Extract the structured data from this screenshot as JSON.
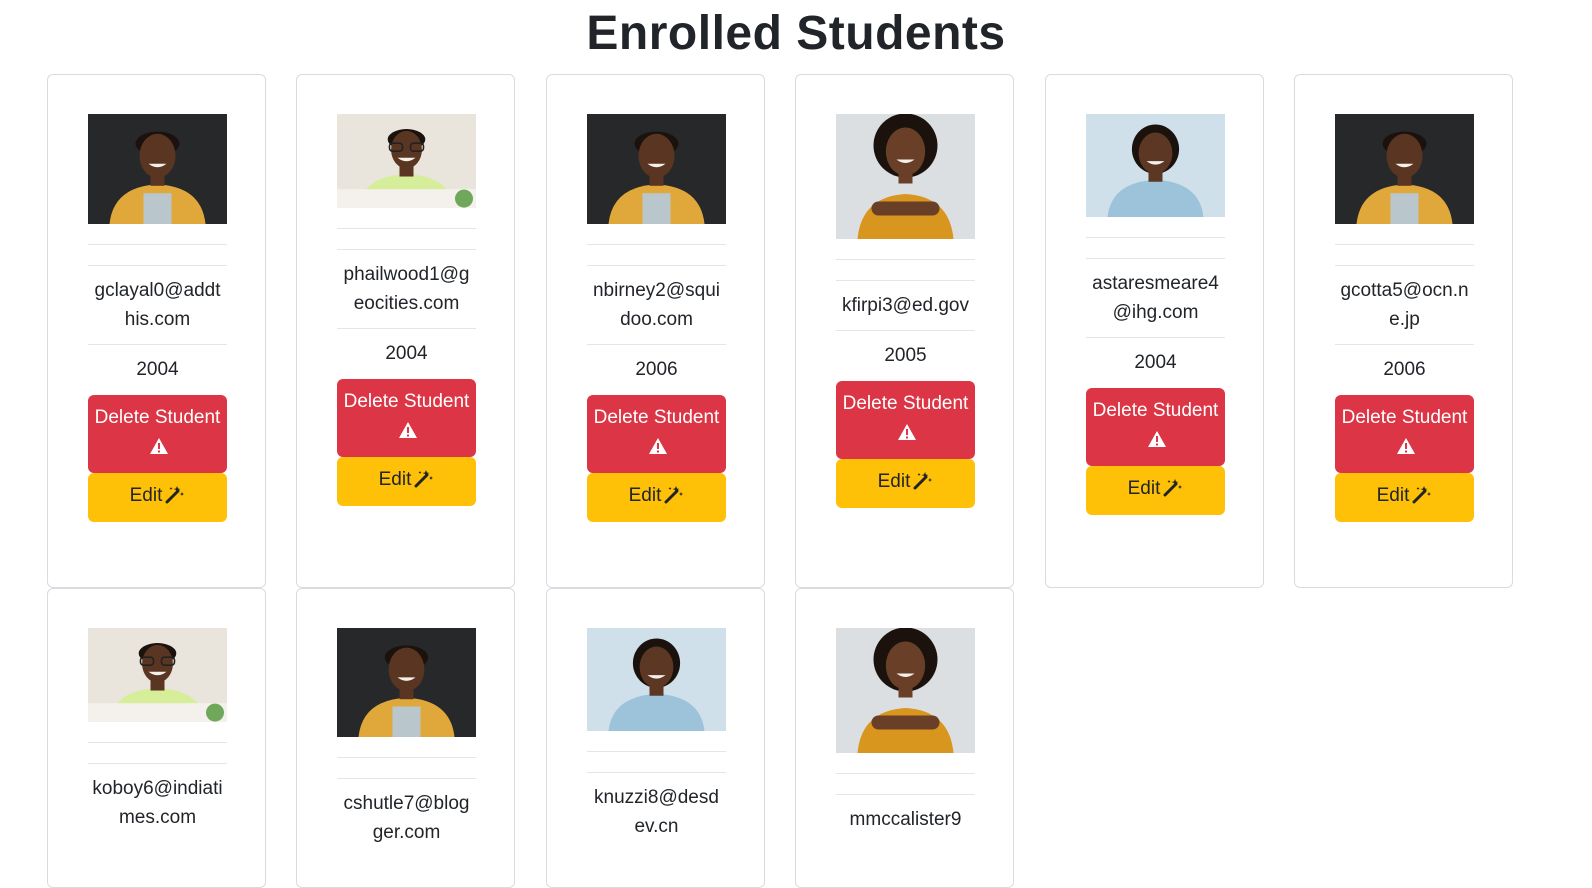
{
  "page": {
    "title": "Enrolled Students"
  },
  "colors": {
    "delete": "#dc3545",
    "edit": "#ffc107"
  },
  "labels": {
    "delete": "Delete Student",
    "edit": "Edit"
  },
  "icons": {
    "delete": "warning-triangle-icon",
    "edit": "magic-wand-icon",
    "photo": "student-photo"
  },
  "students": [
    {
      "email": "gclayal0@addthis.com",
      "year": "2004",
      "photo": "man-yellow-jacket"
    },
    {
      "email": "phailwood1@geocities.com",
      "year": "2004",
      "photo": "man-glasses-green-shirt"
    },
    {
      "email": "nbirney2@squidoo.com",
      "year": "2006",
      "photo": "man-yellow-jacket"
    },
    {
      "email": "kfirpi3@ed.gov",
      "year": "2005",
      "photo": "woman-orange-top"
    },
    {
      "email": "astaresmeare4@ihg.com",
      "year": "2004",
      "photo": "woman-blue-blouse"
    },
    {
      "email": "gcotta5@ocn.ne.jp",
      "year": "2006",
      "photo": "man-yellow-jacket"
    },
    {
      "email": "koboy6@indiatimes.com",
      "year": "",
      "photo": "man-glasses-green-shirt"
    },
    {
      "email": "cshutle7@blogger.com",
      "year": "",
      "photo": "man-yellow-jacket"
    },
    {
      "email": "knuzzi8@desdev.cn",
      "year": "",
      "photo": "woman-blue-blouse"
    },
    {
      "email": "mmccalister9",
      "year": "",
      "photo": "woman-orange-top"
    }
  ]
}
